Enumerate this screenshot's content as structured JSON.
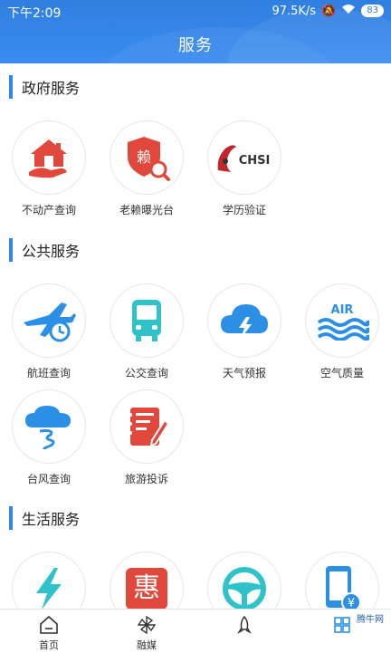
{
  "status_bar": {
    "time": "下午2:09",
    "speed": "97.5K/s",
    "battery": "83"
  },
  "header": {
    "title": "服务"
  },
  "sections": [
    {
      "title": "政府服务",
      "items": [
        {
          "label": "不动产查询",
          "icon": "house-hand-icon"
        },
        {
          "label": "老赖曝光台",
          "icon": "shield-search-icon"
        },
        {
          "label": "学历验证",
          "icon": "chsi-logo-icon"
        }
      ]
    },
    {
      "title": "公共服务",
      "items": [
        {
          "label": "航班查询",
          "icon": "airplane-clock-icon"
        },
        {
          "label": "公交查询",
          "icon": "bus-icon"
        },
        {
          "label": "天气预报",
          "icon": "cloud-lightning-icon"
        },
        {
          "label": "空气质量",
          "icon": "air-waves-icon"
        },
        {
          "label": "台风查询",
          "icon": "typhoon-icon"
        },
        {
          "label": "旅游投诉",
          "icon": "notebook-pen-icon"
        }
      ]
    },
    {
      "title": "生活服务",
      "items": [
        {
          "label": "",
          "icon": "lightning-bolt-icon"
        },
        {
          "label": "惠",
          "icon": "hui-icon"
        },
        {
          "label": "",
          "icon": "steering-wheel-icon"
        },
        {
          "label": "",
          "icon": "phone-yen-icon"
        }
      ]
    }
  ],
  "icon_texts": {
    "shield_char": "赖",
    "chsi": "CHSI",
    "air": "AIR"
  },
  "tabbar": {
    "items": [
      {
        "label": "首页",
        "icon": "home-icon"
      },
      {
        "label": "融媒",
        "icon": "pinwheel-icon"
      },
      {
        "label": "",
        "icon": "rocket-icon"
      },
      {
        "label": "",
        "icon": "grid-icon"
      }
    ]
  },
  "watermark": "腾牛网",
  "colors": {
    "header": "#2f7fe0",
    "section_bar": "#2f87e8",
    "icon_blue": "#2b8fe6",
    "icon_red": "#e1483c",
    "icon_teal": "#2fc3c9"
  }
}
